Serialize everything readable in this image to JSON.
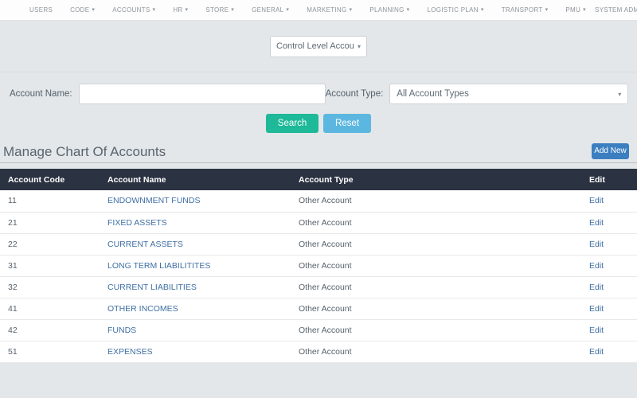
{
  "navbar": {
    "items": [
      {
        "label": "USERS",
        "has_caret": false
      },
      {
        "label": "CODE",
        "has_caret": true
      },
      {
        "label": "ACCOUNTS",
        "has_caret": true
      },
      {
        "label": "HR",
        "has_caret": true
      },
      {
        "label": "STORE",
        "has_caret": true
      },
      {
        "label": "GENERAL",
        "has_caret": true
      },
      {
        "label": "MARKETING",
        "has_caret": true
      },
      {
        "label": "PLANNING",
        "has_caret": true
      },
      {
        "label": "LOGISTIC PLAN",
        "has_caret": true
      },
      {
        "label": "TRANSPORT",
        "has_caret": true
      },
      {
        "label": "PMU",
        "has_caret": true
      }
    ],
    "user_menu": "SYSTEM ADMINISTRATOR",
    "caret_glyph": "▾"
  },
  "level_selector": {
    "selected": "Control Level Accounts",
    "caret_glyph": "▾"
  },
  "filters": {
    "account_name_label": "Account Name:",
    "account_name_value": "",
    "account_name_placeholder": "",
    "account_type_label": "Account Type:",
    "account_type_selected": "All Account Types",
    "caret_glyph": "▾",
    "search_label": "Search",
    "reset_label": "Reset"
  },
  "page": {
    "title": "Manage Chart Of Accounts",
    "add_new_label": "Add New"
  },
  "table": {
    "headers": [
      "Account Code",
      "Account Name",
      "Account Type",
      "Edit"
    ],
    "edit_label": "Edit",
    "rows": [
      {
        "code": "11",
        "name": "ENDOWNMENT FUNDS",
        "type": "Other Account"
      },
      {
        "code": "21",
        "name": "FIXED ASSETS",
        "type": "Other Account"
      },
      {
        "code": "22",
        "name": "CURRENT ASSETS",
        "type": "Other Account"
      },
      {
        "code": "31",
        "name": "LONG TERM LIABILITITES",
        "type": "Other Account"
      },
      {
        "code": "32",
        "name": "CURRENT LIABILITIES",
        "type": "Other Account"
      },
      {
        "code": "41",
        "name": "OTHER INCOMES",
        "type": "Other Account"
      },
      {
        "code": "42",
        "name": "FUNDS",
        "type": "Other Account"
      },
      {
        "code": "51",
        "name": "EXPENSES",
        "type": "Other Account"
      }
    ]
  },
  "colors": {
    "page_bg": "#e3e7e9",
    "navbar_bg": "#fdfdfd",
    "table_header_bg": "#2b3342",
    "search_btn": "#1eb998",
    "reset_btn": "#5cb7e0",
    "add_new_btn": "#3c7fc0",
    "link": "#3f6fa3"
  }
}
